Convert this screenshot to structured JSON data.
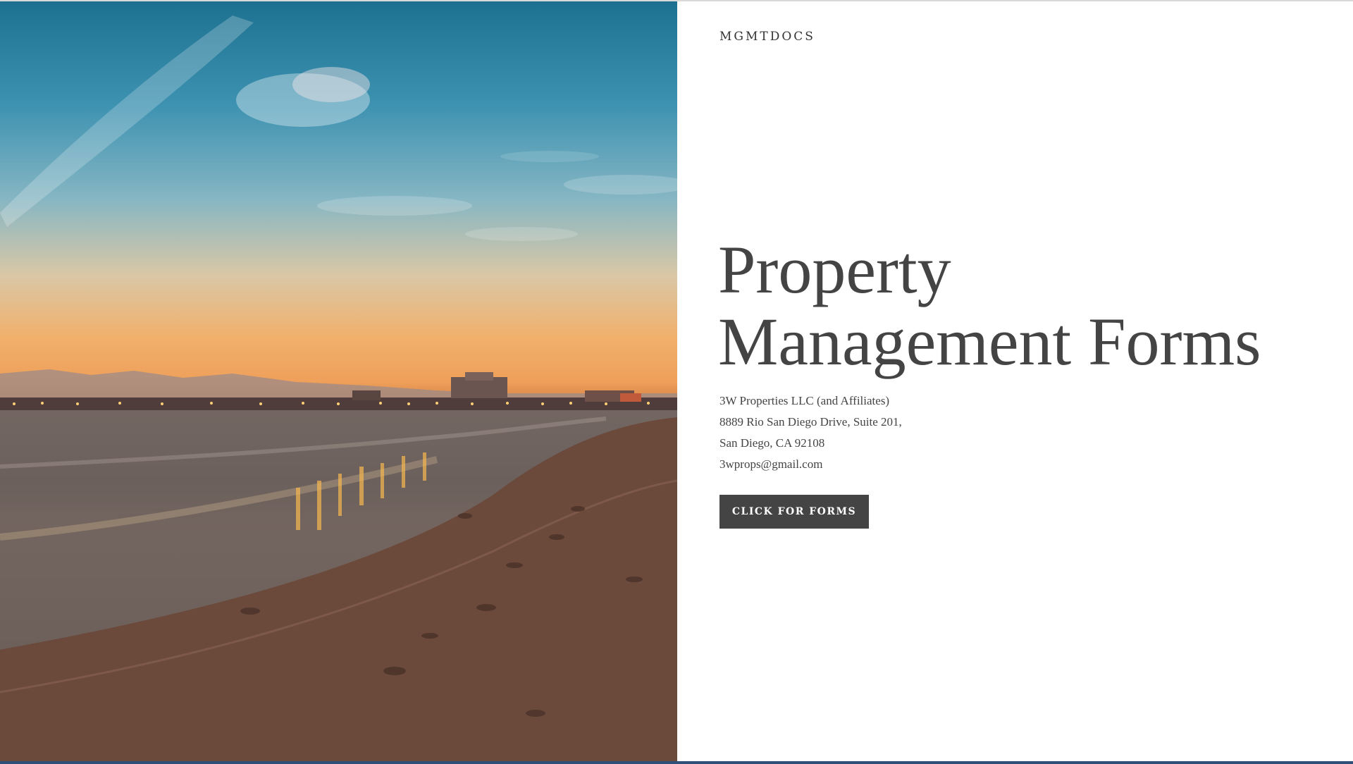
{
  "header": {
    "brand": "MGMTDOCS"
  },
  "hero": {
    "image_subject": "beach-at-sunset-photo",
    "title_line1": "Property",
    "title_line2": "Management Forms",
    "address_lines": [
      "3W Properties LLC (and Affiliates)",
      "8889 Rio San Diego Drive, Suite 201,",
      "San Diego, CA 92108",
      "3wprops@gmail.com"
    ],
    "cta_label": "CLICK FOR FORMS"
  },
  "colors": {
    "text": "#444444",
    "button_bg": "#444444",
    "button_text": "#ffffff",
    "page_bg": "#ffffff"
  }
}
